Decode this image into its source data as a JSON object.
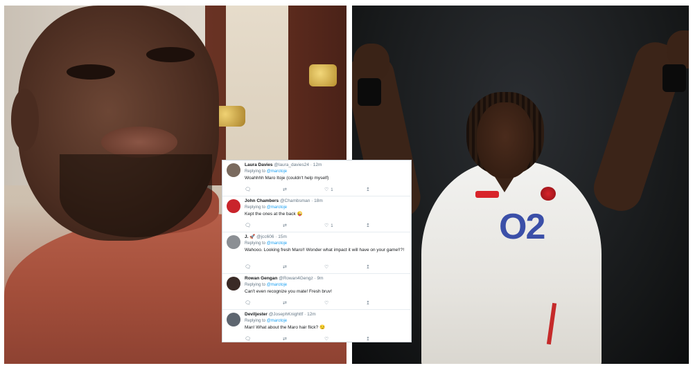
{
  "tweets": [
    {
      "name": "Laura Davies",
      "handle": "@laura_davies24 · 12m",
      "replying_prefix": "Replying to",
      "mention": "@marotoje",
      "text": "Woahhhh Maro Itoje (couldn't help myself)",
      "like_count": "1",
      "avatar_color": "#7a6a5e"
    },
    {
      "name": "John Chambers",
      "handle": "@Chambsman · 18m",
      "replying_prefix": "Replying to",
      "mention": "@marotoje",
      "text": "Kept the ones at the back 😜",
      "like_count": "1",
      "avatar_color": "#c9242b"
    },
    {
      "name": "J. 🚀",
      "handle": "@jcc606 · 15m",
      "replying_prefix": "Replying to",
      "mention": "@marotoje",
      "text": "Wahooo. Looking fresh Maro!! Wonder what impact it will have on your game!!?!",
      "like_count": "",
      "avatar_color": "#8b8f94"
    },
    {
      "name": "Rowan Gengan",
      "handle": "@Rowan4Gengz · 9m",
      "replying_prefix": "Replying to",
      "mention": "@marotoje",
      "text": "Can't even recognize you mate! Fresh bruv!",
      "like_count": "",
      "avatar_color": "#3a2a26"
    },
    {
      "name": "Deviljester",
      "handle": "@JosephKnighttf · 12m",
      "replying_prefix": "Replying to",
      "mention": "@marotoje",
      "text": "Man! What about the Maro hair flick? 😏",
      "like_count": "",
      "avatar_color": "#5e6670"
    }
  ],
  "jersey": {
    "sponsor_logo": "O2",
    "brand_color": "#3b4fa8"
  },
  "icons": {
    "reply": "reply-icon",
    "retweet": "retweet-icon",
    "like": "heart-icon",
    "share": "share-icon"
  }
}
